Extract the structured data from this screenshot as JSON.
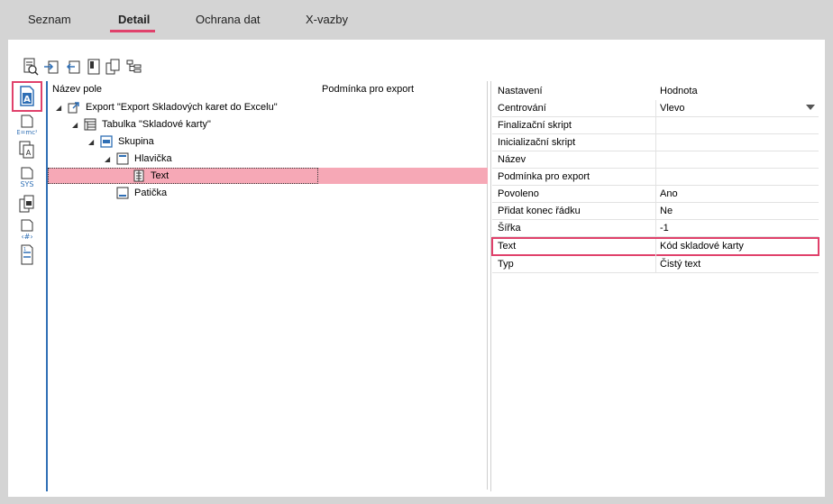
{
  "tabs": [
    {
      "label": "Seznam"
    },
    {
      "label": "Detail"
    },
    {
      "label": "Ochrana dat"
    },
    {
      "label": "X-vazby"
    }
  ],
  "accent": "#e0416b",
  "tree": {
    "col_name": "Název pole",
    "col_condition": "Podmínka pro export",
    "nodes": [
      {
        "label": "Export \"Export Skladových karet do Excelu\""
      },
      {
        "label": "Tabulka \"Skladové karty\""
      },
      {
        "label": "Skupina"
      },
      {
        "label": "Hlavička"
      },
      {
        "label": "Text"
      },
      {
        "label": "Patička"
      }
    ]
  },
  "props": {
    "col_setting": "Nastavení",
    "col_value": "Hodnota",
    "rows": [
      {
        "name": "Centrování",
        "value": "Vlevo"
      },
      {
        "name": "Finalizační skript",
        "value": ""
      },
      {
        "name": "Inicializační skript",
        "value": ""
      },
      {
        "name": "Název",
        "value": ""
      },
      {
        "name": "Podmínka pro export",
        "value": ""
      },
      {
        "name": "Povoleno",
        "value": "Ano"
      },
      {
        "name": "Přidat konec řádku",
        "value": "Ne"
      },
      {
        "name": "Šířka",
        "value": "-1"
      },
      {
        "name": "Text",
        "value": "Kód skladové karty"
      },
      {
        "name": "Typ",
        "value": "Čistý text"
      }
    ]
  }
}
